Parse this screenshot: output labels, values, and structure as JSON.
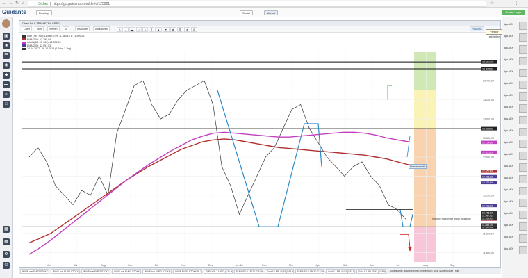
{
  "browser": {
    "security_label": "Sicher",
    "url": "https://go.guidants.com/de#c/125221",
    "tab_desktop": "Desktop",
    "tab_social": "Social",
    "tab_market": "Market",
    "login_label": "Broker Login"
  },
  "app": {
    "logo": "Guidants"
  },
  "panel": {
    "title": "Chart DAX TRA XETRA FREE",
    "toolbar": [
      "Chart",
      "Welt",
      "Werten",
      "1d",
      "6 Monate",
      "Indikatoren"
    ],
    "toolbar_right": "Positions",
    "tooltip": "Fenster schließen",
    "legend": [
      {
        "text": "DAX (XETRA): 11.880,10  H: 11.880,10  L: 11.959,52",
        "color": "#333333"
      },
      {
        "text": "EMA(200): 12.395,84",
        "color": "#b03030"
      },
      {
        "text": "KAMA(38, 10, 200): 12.332,95",
        "color": "#c23fc2"
      },
      {
        "text": "EMA(200): 12.091,53",
        "color": "#4b3c99"
      },
      {
        "text": "24.04.2017 - 16.10.2018  (1 Jahr, 1 Tag)",
        "color": "#333333"
      }
    ],
    "annotations": {
      "widerstand": "Stoneanwendet",
      "hint": "mögliche Nackenlinie großer Belastung"
    }
  },
  "chart_data": {
    "type": "line",
    "title": "DAX (XETRA)",
    "x_months": [
      "Jun",
      "Jul",
      "Aug",
      "Sep",
      "Okt",
      "Nov",
      "Dez",
      "Jan 18",
      "Feb",
      "Mrz",
      "Apr",
      "Mai",
      "Jun",
      "Jul",
      "Aug",
      "Sep"
    ],
    "y_ticks": [
      13600,
      13400,
      13200,
      13000,
      12800,
      12600,
      12400,
      12200,
      12000,
      11800,
      11600
    ],
    "ylim": [
      11500,
      13700
    ],
    "horizontal_levels": [
      {
        "value": 13597,
        "label": "13.597,79"
      },
      {
        "value": 13525,
        "label": "13.525,09"
      },
      {
        "value": 12898,
        "label": "12.898,92"
      },
      {
        "value": 11869,
        "label": "11.869,92"
      }
    ],
    "price_labels": [
      "12.754,60",
      "12.650,15",
      "12.452,45",
      "12.396,18",
      "12.332,46",
      "12.091,53",
      "12.016,00",
      "11.987,62",
      "11.949,82",
      "11.959,92",
      "11.888,10"
    ],
    "series": [
      {
        "name": "DAX (XETRA)",
        "color": "#333333",
        "values": [
          12600,
          12700,
          12550,
          12300,
          12200,
          12100,
          12250,
          12200,
          12400,
          12200,
          12850,
          13100,
          13350,
          13400,
          13150,
          13000,
          13050,
          13200,
          13300,
          13350,
          13400,
          13150,
          12500,
          12300,
          12000,
          12200,
          12400,
          12600,
          12700,
          12900,
          13100,
          13150,
          12900,
          12750,
          12600,
          12500,
          12400,
          12500,
          12550,
          12400,
          12300,
          12100,
          12050,
          11950
        ]
      },
      {
        "name": "EMA(200)",
        "color": "#b03030",
        "values": [
          11700,
          11750,
          11800,
          11880,
          11960,
          12040,
          12120,
          12200,
          12280,
          12360,
          12430,
          12500,
          12560,
          12620,
          12680,
          12720,
          12760,
          12780,
          12790,
          12780,
          12760,
          12740,
          12720,
          12700,
          12690,
          12680,
          12670,
          12660,
          12650,
          12640,
          12630,
          12620,
          12600,
          12580,
          12550,
          12520
        ]
      },
      {
        "name": "KAMA(38, 10, 200)",
        "color": "#c23fc2",
        "values": [
          11580,
          11650,
          11730,
          11820,
          11910,
          12000,
          12090,
          12180,
          12270,
          12360,
          12440,
          12520,
          12590,
          12660,
          12720,
          12780,
          12820,
          12850,
          12860,
          12850,
          12840,
          12830,
          12820,
          12810,
          12810,
          12820,
          12830,
          12840,
          12850,
          12860,
          12860,
          12850,
          12830,
          12800,
          12780,
          12760
        ]
      }
    ]
  },
  "right_rail": {
    "items": [
      "dpa AFX",
      "dpa AFX",
      "dpa AFX",
      "dpa AFX",
      "dpa AFX",
      "dpa AFX",
      "dpa AFX",
      "dpa AFX",
      "dpa AFX",
      "dpa AFX",
      "dpa AFX",
      "dpa AFX",
      "dpa AFX",
      "dpa AFX",
      "dpa AFX",
      "dpa AFX",
      "dpa AFX",
      "dpa AFX",
      "dpa AFX",
      "dpa AFX"
    ]
  },
  "bottom_tabs": [
    "WAVE aus EURO STOXX 50",
    "WAVE aus EURO STOXX 50",
    "WAVE aus EURO STOXX 50",
    "WAVE aus EURO STOXX 50",
    "WAVE aus EURO STOXX 50",
    "WAVE EURO STOXX 50 1.25%",
    "EUR/USD 1.15077 (2.31 %)",
    "EUR/USD 1.15027 (2.31 %)",
    "Gold 1:1 PPI 43,93 (3.93 %)",
    "EUR/USD 1.15027 (2.31 %)",
    "Gold 1:1 PPI 43,93 (3.93 %)",
    "Gold 1:1 PPI 43,93 (3.93 %)"
  ],
  "footer": "Supersuche | ausgezeichnet | Impressum | AGB | Datenschutz | Hilfe",
  "colors": {
    "green_zone": "#cfe8b4",
    "yellow_zone": "#fbf3b5",
    "orange_zone": "#f9d3b0",
    "pink_zone": "#f7c7d9",
    "blue_channel": "#2e8bc9"
  }
}
